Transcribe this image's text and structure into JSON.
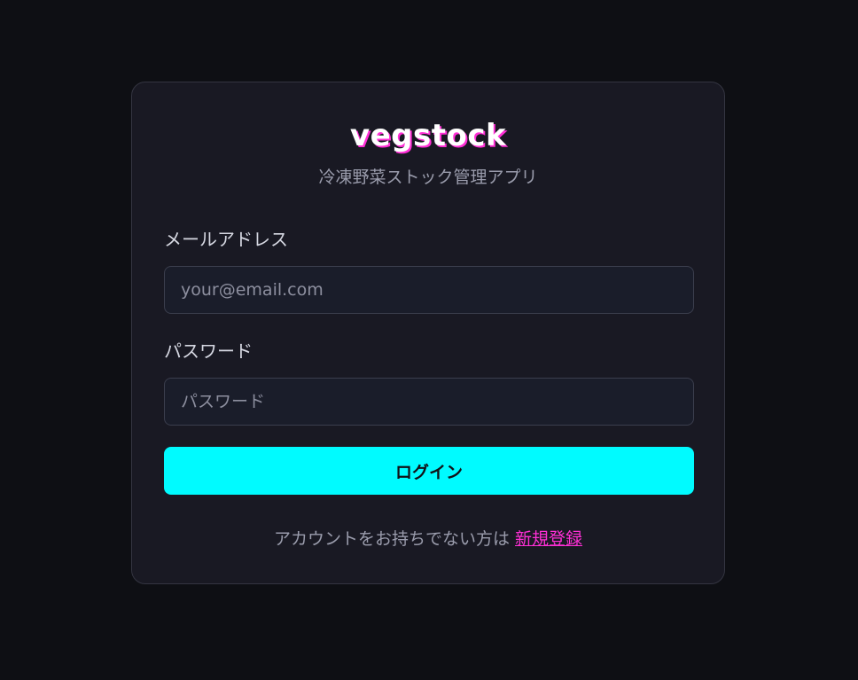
{
  "app": {
    "logo_text": "vegstock",
    "subtitle": "冷凍野菜ストック管理アプリ"
  },
  "form": {
    "email_label": "メールアドレス",
    "email_placeholder": "your@email.com",
    "email_value": "",
    "password_label": "パスワード",
    "password_placeholder": "パスワード",
    "password_value": "",
    "login_button_label": "ログイン"
  },
  "footer": {
    "prompt_text": "アカウントをお持ちでない方は",
    "signup_link_text": "新規登録"
  },
  "colors": {
    "page_background": "#0e0f14",
    "card_background": "#191923",
    "accent_cyan": "#00fbff",
    "accent_magenta": "#ff2fd6"
  }
}
